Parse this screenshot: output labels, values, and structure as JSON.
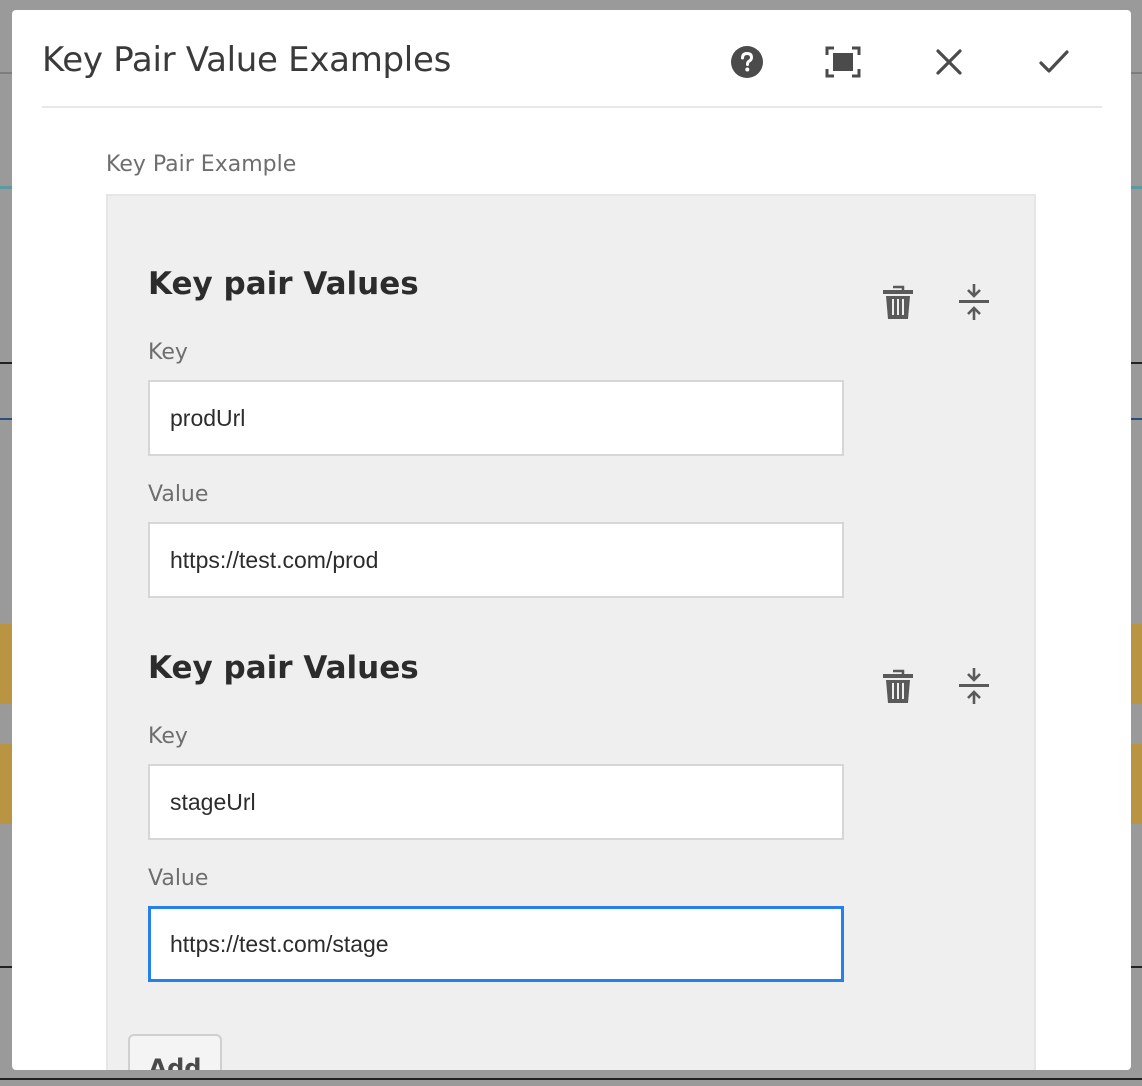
{
  "dialog": {
    "title": "Key Pair Value Examples",
    "actions": [
      "help-icon",
      "fullscreen-icon",
      "close-icon",
      "done-icon"
    ]
  },
  "field": {
    "label": "Key Pair Example",
    "items": [
      {
        "title": "Key pair Values",
        "key_label": "Key",
        "key_value": "prodUrl",
        "value_label": "Value",
        "value_value": "https://test.com/prod"
      },
      {
        "title": "Key pair Values",
        "key_label": "Key",
        "key_value": "stageUrl",
        "value_label": "Value",
        "value_value": "https://test.com/stage"
      }
    ],
    "add_label": "Add"
  },
  "colors": {
    "focus": "#2680eb",
    "panel": "#efefef",
    "background_accent": "#b99442"
  }
}
